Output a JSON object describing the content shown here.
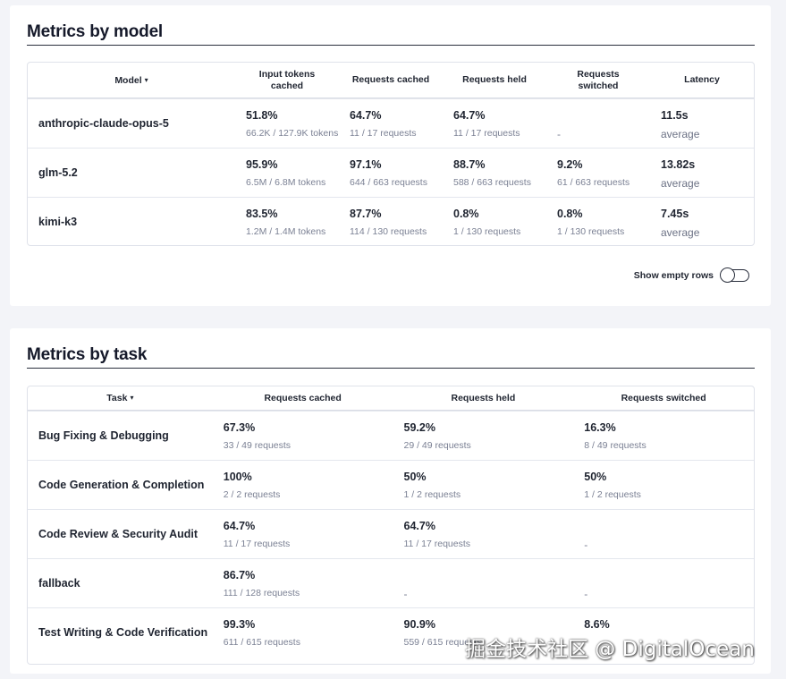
{
  "model_section": {
    "title": "Metrics by model",
    "headers": [
      "Model",
      "Input tokens cached",
      "Requests cached",
      "Requests held",
      "Requests switched",
      "Latency"
    ],
    "header_lines": {
      "input_tokens_1": "Input tokens",
      "input_tokens_2": "cached",
      "switched_1": "Requests",
      "switched_2": "switched"
    },
    "sort_caret": "▾",
    "rows": [
      {
        "name": "anthropic-claude-opus-5",
        "input_tokens": {
          "value": "51.8%",
          "detail": "66.2K / 127.9K tokens"
        },
        "cached": {
          "value": "64.7%",
          "detail": "11 / 17 requests"
        },
        "held": {
          "value": "64.7%",
          "detail": "11 / 17 requests"
        },
        "switched": {
          "value": "-",
          "detail": ""
        },
        "latency": {
          "value": "11.5s",
          "detail": "average"
        }
      },
      {
        "name": "glm-5.2",
        "input_tokens": {
          "value": "95.9%",
          "detail": "6.5M / 6.8M tokens"
        },
        "cached": {
          "value": "97.1%",
          "detail": "644 / 663 requests"
        },
        "held": {
          "value": "88.7%",
          "detail": "588 / 663 requests"
        },
        "switched": {
          "value": "9.2%",
          "detail": "61 / 663 requests"
        },
        "latency": {
          "value": "13.82s",
          "detail": "average"
        }
      },
      {
        "name": "kimi-k3",
        "input_tokens": {
          "value": "83.5%",
          "detail": "1.2M / 1.4M tokens"
        },
        "cached": {
          "value": "87.7%",
          "detail": "114 / 130 requests"
        },
        "held": {
          "value": "0.8%",
          "detail": "1 / 130 requests"
        },
        "switched": {
          "value": "0.8%",
          "detail": "1 / 130 requests"
        },
        "latency": {
          "value": "7.45s",
          "detail": "average"
        }
      }
    ],
    "toggle": {
      "label": "Show empty rows",
      "on": false
    }
  },
  "task_section": {
    "title": "Metrics by task",
    "headers": [
      "Task",
      "Requests cached",
      "Requests held",
      "Requests switched"
    ],
    "sort_caret": "▾",
    "rows": [
      {
        "name": "Bug Fixing & Debugging",
        "cached": {
          "value": "67.3%",
          "detail": "33 / 49 requests"
        },
        "held": {
          "value": "59.2%",
          "detail": "29 / 49 requests"
        },
        "switched": {
          "value": "16.3%",
          "detail": "8 / 49 requests"
        }
      },
      {
        "name": "Code Generation & Completion",
        "cached": {
          "value": "100%",
          "detail": "2 / 2 requests"
        },
        "held": {
          "value": "50%",
          "detail": "1 / 2 requests"
        },
        "switched": {
          "value": "50%",
          "detail": "1 / 2 requests"
        }
      },
      {
        "name": "Code Review & Security Audit",
        "cached": {
          "value": "64.7%",
          "detail": "11 / 17 requests"
        },
        "held": {
          "value": "64.7%",
          "detail": "11 / 17 requests"
        },
        "switched": {
          "value": "-",
          "detail": ""
        }
      },
      {
        "name": "fallback",
        "cached": {
          "value": "86.7%",
          "detail": "111 / 128 requests"
        },
        "held": {
          "value": "-",
          "detail": ""
        },
        "switched": {
          "value": "-",
          "detail": ""
        }
      },
      {
        "name": "Test Writing & Code Verification",
        "cached": {
          "value": "99.3%",
          "detail": "611 / 615 requests"
        },
        "held": {
          "value": "90.9%",
          "detail": "559 / 615 requests"
        },
        "switched": {
          "value": "8.6%",
          "detail": ""
        }
      }
    ]
  },
  "watermark": "掘金技术社区 @ DigitalOcean"
}
